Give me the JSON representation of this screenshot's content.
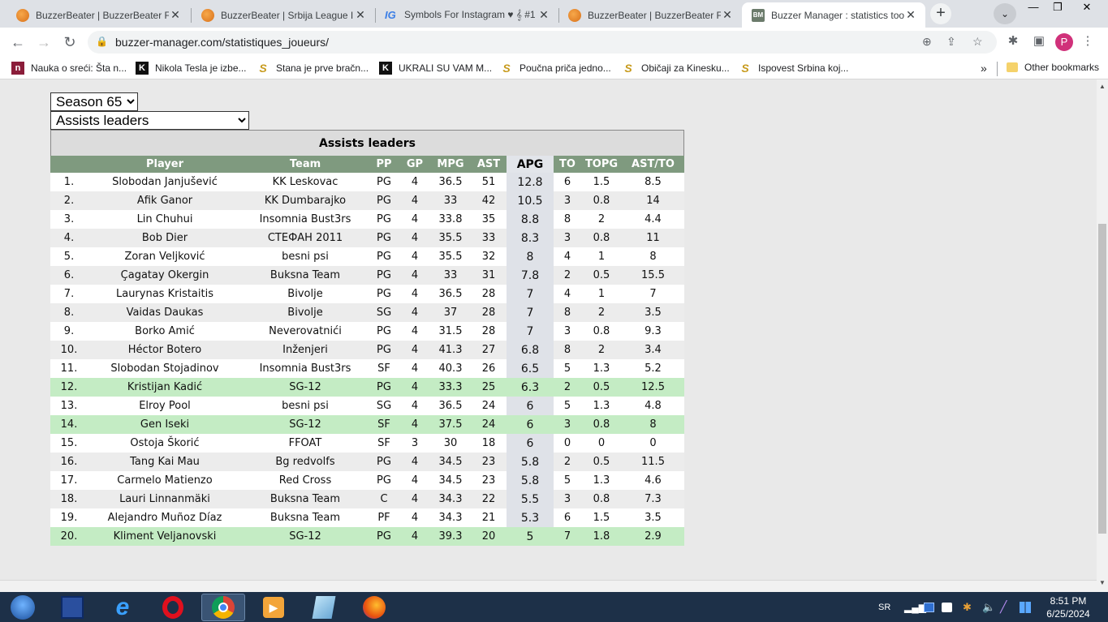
{
  "tabs": [
    {
      "title": "BuzzerBeater | BuzzerBeater Fo",
      "icon": "basketball-icon",
      "active": false
    },
    {
      "title": "BuzzerBeater | Srbija League II.",
      "icon": "basketball-icon",
      "active": false
    },
    {
      "title": "Symbols For Instagram ♥ 𝄞 #1",
      "icon": "ig-icon",
      "active": false
    },
    {
      "title": "BuzzerBeater | BuzzerBeater Fo",
      "icon": "basketball-icon",
      "active": false
    },
    {
      "title": "Buzzer Manager : statistics too",
      "icon": "bm-icon",
      "active": true
    }
  ],
  "address": {
    "url": "buzzer-manager.com/statistiques_joueurs/"
  },
  "profile_initial": "P",
  "bookmarks": [
    {
      "label": "Nauka o sreći: Šta n...",
      "icon": "n"
    },
    {
      "label": "Nikola Tesla je izbe...",
      "icon": "K"
    },
    {
      "label": "Stana je prve bračn...",
      "icon": "S"
    },
    {
      "label": "UKRALI SU VAM M...",
      "icon": "K"
    },
    {
      "label": "Poučna priča jedno...",
      "icon": "S"
    },
    {
      "label": "Običaji za Kinesku...",
      "icon": "S"
    },
    {
      "label": "Ispovest Srbina koj...",
      "icon": "S"
    }
  ],
  "other_bookmarks": "Other bookmarks",
  "season_select": {
    "value": "Season 65"
  },
  "category_select": {
    "value": "Assists leaders"
  },
  "table": {
    "caption": "Assists leaders",
    "headers": [
      "",
      "Player",
      "Team",
      "PP",
      "GP",
      "MPG",
      "AST",
      "APG",
      "TO",
      "TOPG",
      "AST/TO"
    ],
    "rows": [
      {
        "rank": "1.",
        "player": "Slobodan Janjušević",
        "team": "KK Leskovac",
        "pp": "PG",
        "gp": "4",
        "mpg": "36.5",
        "ast": "51",
        "apg": "12.8",
        "to": "6",
        "topg": "1.5",
        "astto": "8.5",
        "hl": false
      },
      {
        "rank": "2.",
        "player": "Afik Ganor",
        "team": "KK Dumbarajko",
        "pp": "PG",
        "gp": "4",
        "mpg": "33",
        "ast": "42",
        "apg": "10.5",
        "to": "3",
        "topg": "0.8",
        "astto": "14",
        "hl": false
      },
      {
        "rank": "3.",
        "player": "Lin Chuhui",
        "team": "Insomnia Bust3rs",
        "pp": "PG",
        "gp": "4",
        "mpg": "33.8",
        "ast": "35",
        "apg": "8.8",
        "to": "8",
        "topg": "2",
        "astto": "4.4",
        "hl": false
      },
      {
        "rank": "4.",
        "player": "Bob Dier",
        "team": "СТЕФАН 2011",
        "pp": "PG",
        "gp": "4",
        "mpg": "35.5",
        "ast": "33",
        "apg": "8.3",
        "to": "3",
        "topg": "0.8",
        "astto": "11",
        "hl": false
      },
      {
        "rank": "5.",
        "player": "Zoran Veljković",
        "team": "besni psi",
        "pp": "PG",
        "gp": "4",
        "mpg": "35.5",
        "ast": "32",
        "apg": "8",
        "to": "4",
        "topg": "1",
        "astto": "8",
        "hl": false
      },
      {
        "rank": "6.",
        "player": "Çagatay Okergin",
        "team": "Buksna Team",
        "pp": "PG",
        "gp": "4",
        "mpg": "33",
        "ast": "31",
        "apg": "7.8",
        "to": "2",
        "topg": "0.5",
        "astto": "15.5",
        "hl": false
      },
      {
        "rank": "7.",
        "player": "Laurynas Kristaitis",
        "team": "Bivolje",
        "pp": "PG",
        "gp": "4",
        "mpg": "36.5",
        "ast": "28",
        "apg": "7",
        "to": "4",
        "topg": "1",
        "astto": "7",
        "hl": false
      },
      {
        "rank": "8.",
        "player": "Vaidas Daukas",
        "team": "Bivolje",
        "pp": "SG",
        "gp": "4",
        "mpg": "37",
        "ast": "28",
        "apg": "7",
        "to": "8",
        "topg": "2",
        "astto": "3.5",
        "hl": false
      },
      {
        "rank": "9.",
        "player": "Borko Amić",
        "team": "Neverovatnići",
        "pp": "PG",
        "gp": "4",
        "mpg": "31.5",
        "ast": "28",
        "apg": "7",
        "to": "3",
        "topg": "0.8",
        "astto": "9.3",
        "hl": false
      },
      {
        "rank": "10.",
        "player": "Héctor Botero",
        "team": "Inženjeri",
        "pp": "PG",
        "gp": "4",
        "mpg": "41.3",
        "ast": "27",
        "apg": "6.8",
        "to": "8",
        "topg": "2",
        "astto": "3.4",
        "hl": false
      },
      {
        "rank": "11.",
        "player": "Slobodan Stojadinov",
        "team": "Insomnia Bust3rs",
        "pp": "SF",
        "gp": "4",
        "mpg": "40.3",
        "ast": "26",
        "apg": "6.5",
        "to": "5",
        "topg": "1.3",
        "astto": "5.2",
        "hl": false
      },
      {
        "rank": "12.",
        "player": "Kristijan Kadić",
        "team": "SG-12",
        "pp": "PG",
        "gp": "4",
        "mpg": "33.3",
        "ast": "25",
        "apg": "6.3",
        "to": "2",
        "topg": "0.5",
        "astto": "12.5",
        "hl": true
      },
      {
        "rank": "13.",
        "player": "Elroy Pool",
        "team": "besni psi",
        "pp": "SG",
        "gp": "4",
        "mpg": "36.5",
        "ast": "24",
        "apg": "6",
        "to": "5",
        "topg": "1.3",
        "astto": "4.8",
        "hl": false
      },
      {
        "rank": "14.",
        "player": "Gen Iseki",
        "team": "SG-12",
        "pp": "SF",
        "gp": "4",
        "mpg": "37.5",
        "ast": "24",
        "apg": "6",
        "to": "3",
        "topg": "0.8",
        "astto": "8",
        "hl": true
      },
      {
        "rank": "15.",
        "player": "Ostoja Škorić",
        "team": "FFOAT",
        "pp": "SF",
        "gp": "3",
        "mpg": "30",
        "ast": "18",
        "apg": "6",
        "to": "0",
        "topg": "0",
        "astto": "0",
        "hl": false
      },
      {
        "rank": "16.",
        "player": "Tang Kai Mau",
        "team": "Bg redvolfs",
        "pp": "PG",
        "gp": "4",
        "mpg": "34.5",
        "ast": "23",
        "apg": "5.8",
        "to": "2",
        "topg": "0.5",
        "astto": "11.5",
        "hl": false
      },
      {
        "rank": "17.",
        "player": "Carmelo Matienzo",
        "team": "Red Cross",
        "pp": "PG",
        "gp": "4",
        "mpg": "34.5",
        "ast": "23",
        "apg": "5.8",
        "to": "5",
        "topg": "1.3",
        "astto": "4.6",
        "hl": false
      },
      {
        "rank": "18.",
        "player": "Lauri Linnanmäki",
        "team": "Buksna Team",
        "pp": "C",
        "gp": "4",
        "mpg": "34.3",
        "ast": "22",
        "apg": "5.5",
        "to": "3",
        "topg": "0.8",
        "astto": "7.3",
        "hl": false
      },
      {
        "rank": "19.",
        "player": "Alejandro Muñoz Díaz",
        "team": "Buksna Team",
        "pp": "PF",
        "gp": "4",
        "mpg": "34.3",
        "ast": "21",
        "apg": "5.3",
        "to": "6",
        "topg": "1.5",
        "astto": "3.5",
        "hl": false
      },
      {
        "rank": "20.",
        "player": "Kliment Veljanovski",
        "team": "SG-12",
        "pp": "PG",
        "gp": "4",
        "mpg": "39.3",
        "ast": "20",
        "apg": "5",
        "to": "7",
        "topg": "1.8",
        "astto": "2.9",
        "hl": true
      }
    ]
  },
  "taskbar": {
    "lang": "SR",
    "time": "8:51 PM",
    "date": "6/25/2024"
  },
  "colors": {
    "header_green": "#7f9a7f",
    "highlight_row": "#c4ecc4",
    "sorted_column": "#dfe2e8"
  }
}
